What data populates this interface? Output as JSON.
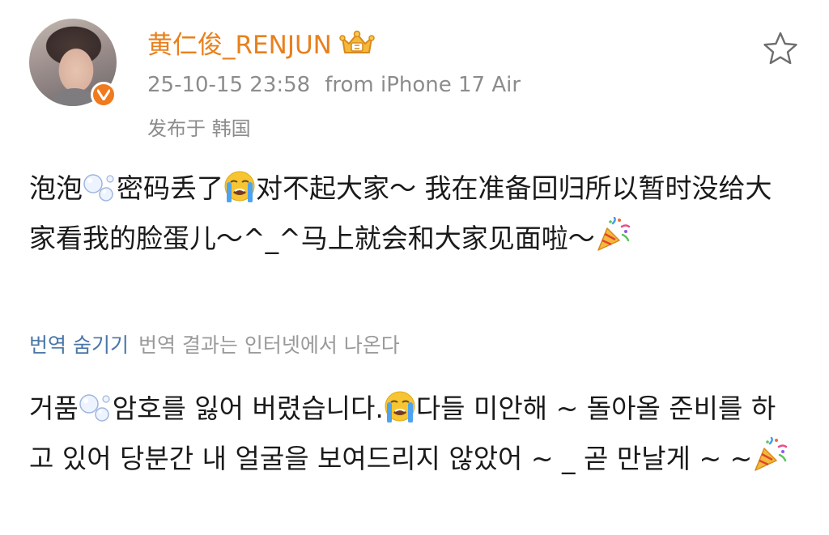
{
  "post": {
    "author": {
      "name": "黄仁俊_RENJUN",
      "avatar_icon": "profile-photo",
      "verified_icon": "verified-v-badge",
      "crown_icon": "crown-icon",
      "accent_color": "#e8801e"
    },
    "timestamp": "25-10-15 23:58",
    "source": "from iPhone 17 Air",
    "location": "发布于 韩国",
    "favorite_icon": "star-icon",
    "text_zh": {
      "part1": "泡泡",
      "part2": "密码丢了",
      "part3": "对不起大家～ 我在准备回归所以暂时没给大家看我的脸蛋儿～^_^马上就会和大家见面啦～"
    },
    "translate": {
      "hide_label": "번역 숨기기",
      "note": "번역 결과는 인터넷에서 나온다",
      "link_color": "#4a76a8"
    },
    "text_ko": {
      "part1": "거품",
      "part2": "암호를 잃어 버렸습니다.",
      "part3": "다들 미안해 ~ 돌아올 준비를 하고 있어 당분간 내 얼굴을 보여드리지 않았어 ~ _ 곧 만날게 ~ ~"
    },
    "emoji": {
      "bubbles": "bubbles-emoji",
      "crying": "loudly-crying-face-emoji",
      "party": "party-popper-emoji"
    }
  }
}
